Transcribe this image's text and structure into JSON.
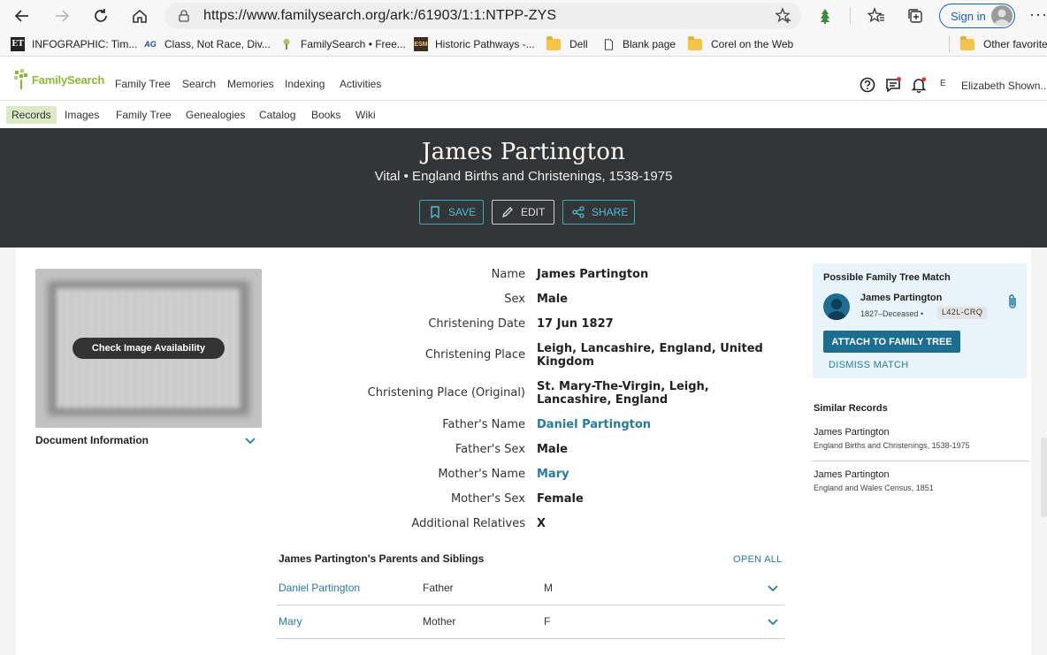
{
  "browser": {
    "url": "https://www.familysearch.org/ark:/61903/1:1:NTPP-ZYS",
    "signin_label": "Sign in",
    "bookmarks": [
      {
        "label": "INFOGRAPHIC: Tim...",
        "icon": "et-icon"
      },
      {
        "label": "Class, Not Race, Div...",
        "icon": "ag-icon"
      },
      {
        "label": "FamilySearch • Free...",
        "icon": "familysearch-tree-icon"
      },
      {
        "label": "Historic Pathways -...",
        "icon": "hp-icon"
      },
      {
        "label": "Dell",
        "icon": "folder-icon"
      },
      {
        "label": "Blank page",
        "icon": "page-icon"
      },
      {
        "label": "Corel on the Web",
        "icon": "folder-icon"
      }
    ],
    "other_favorites": "Other favorite"
  },
  "site": {
    "logo": "FamilySearch",
    "top_nav": [
      "Family Tree",
      "Search",
      "Memories",
      "Indexing",
      "Activities"
    ],
    "user_initial": "E",
    "user_name": "Elizabeth Shown...",
    "sub_nav": [
      "Records",
      "Images",
      "Family Tree",
      "Genealogies",
      "Catalog",
      "Books",
      "Wiki"
    ]
  },
  "hero": {
    "name": "James Partington",
    "subtitle": "Vital • England Births and Christenings, 1538-1975",
    "buttons": {
      "save": "SAVE",
      "edit": "EDIT",
      "share": "SHARE"
    }
  },
  "image_panel": {
    "cta": "Check Image Availability",
    "doc_info": "Document Information"
  },
  "record": {
    "fields": [
      {
        "label": "Name",
        "value": "James Partington",
        "link": false
      },
      {
        "label": "Sex",
        "value": "Male",
        "link": false
      },
      {
        "label": "Christening Date",
        "value": "17 Jun 1827",
        "link": false
      },
      {
        "label": "Christening Place",
        "value": "Leigh, Lancashire, England, United Kingdom",
        "link": false
      },
      {
        "label": "Christening Place (Original)",
        "value": "St. Mary-The-Virgin, Leigh, Lancashire, England",
        "link": false
      },
      {
        "label": "Father's Name",
        "value": "Daniel Partington",
        "link": true
      },
      {
        "label": "Father's Sex",
        "value": "Male",
        "link": false
      },
      {
        "label": "Mother's Name",
        "value": "Mary",
        "link": true
      },
      {
        "label": "Mother's Sex",
        "value": "Female",
        "link": false
      },
      {
        "label": "Additional Relatives",
        "value": "X",
        "link": false
      }
    ]
  },
  "parents": {
    "title": "James Partington's Parents and Siblings",
    "open_all": "OPEN ALL",
    "rows": [
      {
        "name": "Daniel Partington",
        "relationship": "Father",
        "sex": "M"
      },
      {
        "name": "Mary",
        "relationship": "Mother",
        "sex": "F"
      }
    ]
  },
  "match": {
    "title": "Possible Family Tree Match",
    "name": "James Partington",
    "lifespan": "1827–Deceased •",
    "pid": "L42L-CRQ",
    "attach": "ATTACH TO FAMILY TREE",
    "dismiss": "DISMISS MATCH"
  },
  "similar": {
    "title": "Similar Records",
    "items": [
      {
        "name": "James Partington",
        "collection": "England Births and Christenings, 1538-1975"
      },
      {
        "name": "James Partington",
        "collection": "England and Wales Census, 1851"
      }
    ]
  },
  "colors": {
    "accent": "#277aa2",
    "hero_bg": "#333537",
    "brand_green": "#8cb833",
    "attach_btn": "#1b6e8f"
  }
}
